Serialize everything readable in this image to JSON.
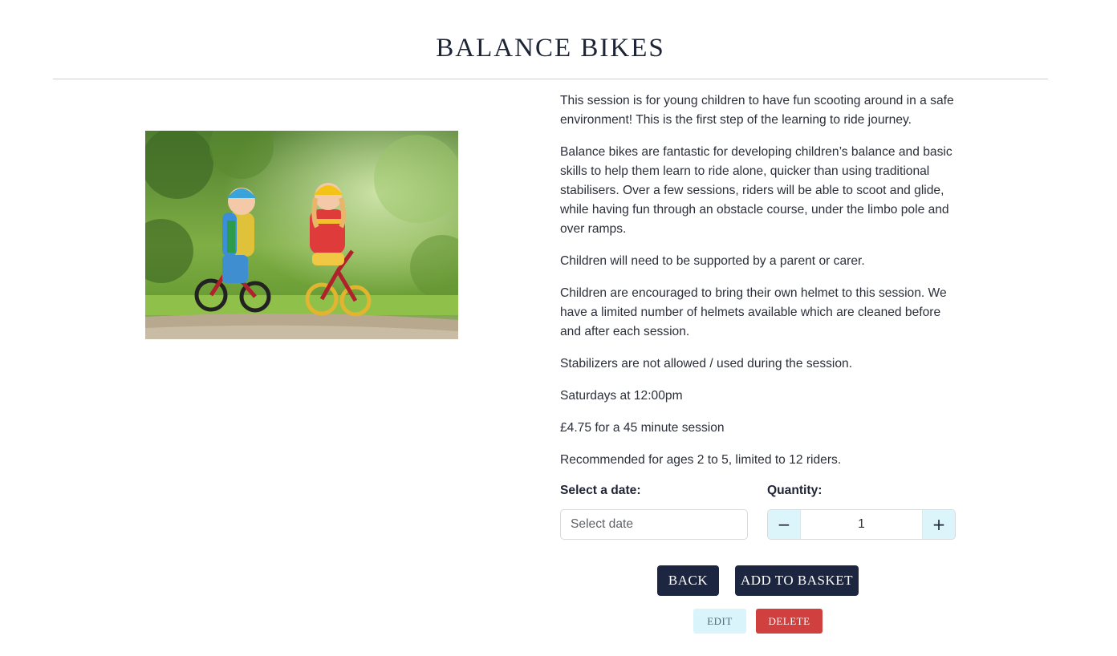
{
  "page": {
    "title": "BALANCE BIKES"
  },
  "product": {
    "image_alt": "Two children riding balance bikes in a forest park",
    "description": [
      "This session is for young children to have fun scooting around in a safe environment! This is the first step of the learning to ride journey.",
      "Balance bikes are fantastic for developing children’s balance and basic skills to help them learn to ride alone, quicker than using traditional stabilisers. Over a few sessions, riders will be able to scoot and glide, while having fun through an obstacle course, under the limbo pole and over ramps.",
      "Children will need to be supported by a parent or carer.",
      "Children are encouraged to bring their own helmet to this session. We have a limited number of helmets available which are cleaned before and after each session.",
      "Stabilizers are not allowed / used during the session.",
      "Saturdays at 12:00pm",
      "£4.75 for a 45 minute session",
      "Recommended for ages 2 to 5, limited to 12 riders."
    ]
  },
  "form": {
    "date_label": "Select a date:",
    "date_placeholder": "Select date",
    "date_value": "",
    "quantity_label": "Quantity:",
    "quantity_value": "1",
    "decrement_symbol": "−",
    "increment_symbol": "+"
  },
  "actions": {
    "back_label": "BACK",
    "add_to_basket_label": "ADD TO BASKET",
    "edit_label": "EDIT",
    "delete_label": "DELETE"
  },
  "colors": {
    "primary_dark": "#1c2640",
    "light_accent": "#dcf5fb",
    "danger": "#d0403f"
  }
}
